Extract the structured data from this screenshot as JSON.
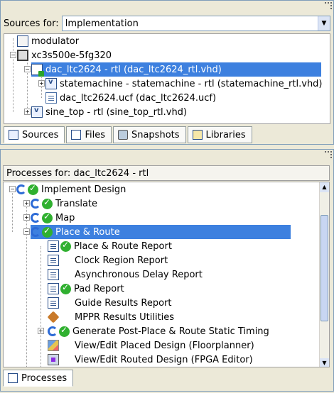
{
  "sources": {
    "label": "Sources for:",
    "selected": "Implementation",
    "tree": [
      {
        "label": "modulator",
        "icon": "module-icon"
      },
      {
        "label": "xc3s500e-5fg320",
        "icon": "chip-icon"
      },
      {
        "label": "dac_ltc2624 - rtl (dac_ltc2624_rtl.vhd)",
        "icon": "top-module-icon",
        "selected": true
      },
      {
        "label": "statemachine - statemachine - rtl (statemachine_rtl.vhd)",
        "icon": "vhdl-file-icon"
      },
      {
        "label": "dac_ltc2624.ucf (dac_ltc2624.ucf)",
        "icon": "ucf-file-icon"
      },
      {
        "label": "sine_top - rtl (sine_top_rtl.vhd)",
        "icon": "vhdl-file-icon"
      }
    ],
    "tabs": [
      "Sources",
      "Files",
      "Snapshots",
      "Libraries"
    ]
  },
  "processes": {
    "header": "Processes for: dac_ltc2624 - rtl",
    "tree": [
      {
        "label": "Implement Design"
      },
      {
        "label": "Translate"
      },
      {
        "label": "Map"
      },
      {
        "label": "Place & Route",
        "selected": true
      },
      {
        "label": "Place & Route Report"
      },
      {
        "label": "Clock Region Report"
      },
      {
        "label": "Asynchronous Delay Report"
      },
      {
        "label": "Pad Report"
      },
      {
        "label": "Guide Results Report"
      },
      {
        "label": "MPPR Results Utilities"
      },
      {
        "label": "Generate Post-Place & Route Static Timing"
      },
      {
        "label": "View/Edit Placed Design (Floorplanner)"
      },
      {
        "label": "View/Edit Routed Design (FPGA Editor)"
      }
    ],
    "tabs": [
      "Processes"
    ]
  },
  "colors": {
    "selection": "#3d80df",
    "ok": "#30b030",
    "panel": "#ece9d8"
  }
}
